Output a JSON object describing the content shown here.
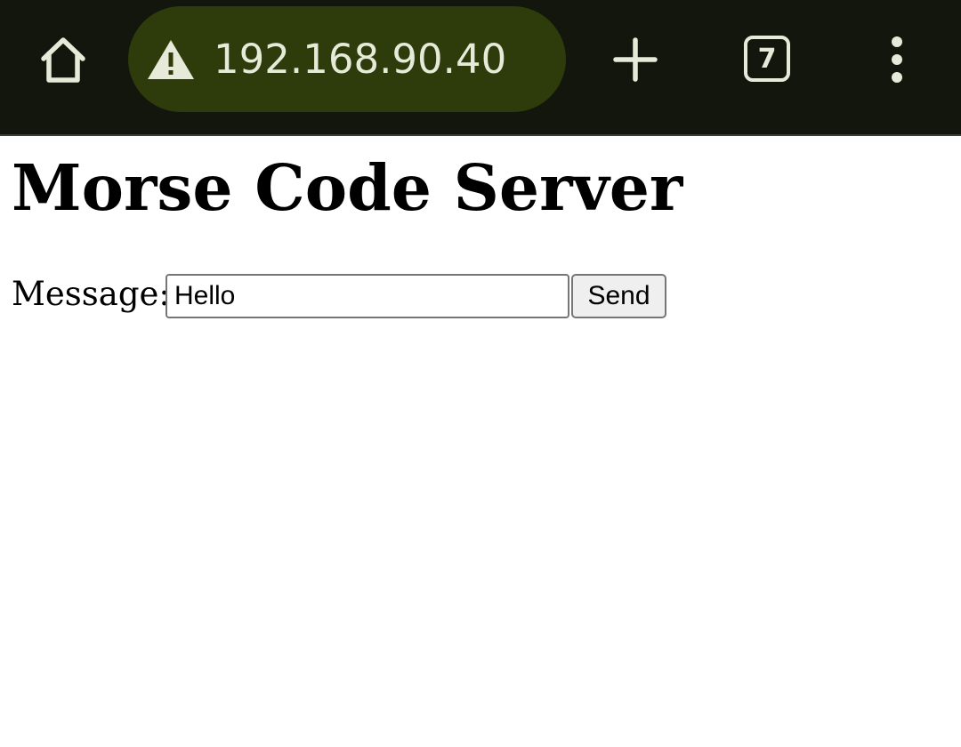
{
  "browser": {
    "url": "192.168.90.40",
    "tab_count": "7",
    "icons": {
      "home": "home-icon",
      "security": "warning-icon",
      "new_tab": "plus-icon",
      "menu": "more-vert-icon"
    },
    "colors": {
      "toolbar_bg": "#12160c",
      "url_pill_bg": "#2e3b0b",
      "icon_color": "#e6ead9"
    }
  },
  "page": {
    "title": "Morse Code Server",
    "form": {
      "label": "Message:",
      "input_value": "Hello",
      "button_label": "Send"
    }
  }
}
